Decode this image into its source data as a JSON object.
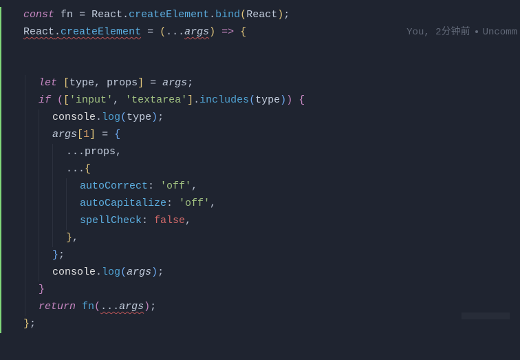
{
  "code": {
    "line1": {
      "const": "const",
      "varfn": "fn",
      "eq": " = ",
      "react": "React",
      "dot1": ".",
      "ce": "createElement",
      "dot2": ".",
      "bind": "bind",
      "lp": "(",
      "react2": "React",
      "rp": ")",
      "semi": ";"
    },
    "line2": {
      "react": "React",
      "dot": ".",
      "ce": "createElement",
      "eq": " = ",
      "lp": "(",
      "spread": "...",
      "args": "args",
      "rp": ")",
      "arrow": " => ",
      "lb": "{"
    },
    "line3": {
      "let": "let",
      "lsb": " [",
      "type": "type",
      "comma": ", ",
      "props": "props",
      "rsb": "] ",
      "eq": "= ",
      "args": "args",
      "semi": ";"
    },
    "line4": {
      "if": "if",
      "lp": " (",
      "lsb": "[",
      "s1": "'input'",
      "comma": ", ",
      "s2": "'textarea'",
      "rsb": "]",
      "dot": ".",
      "includes": "includes",
      "lp2": "(",
      "type": "type",
      "rp2": ")",
      "rp": ") ",
      "lb": "{"
    },
    "line5": {
      "console": "console",
      "dot": ".",
      "log": "log",
      "lp": "(",
      "type": "type",
      "rp": ")",
      "semi": ";"
    },
    "line6": {
      "args": "args",
      "lsb": "[",
      "one": "1",
      "rsb": "]",
      "eq": " = ",
      "lb": "{"
    },
    "line7": {
      "spread": "...",
      "props": "props",
      "comma": ","
    },
    "line8": {
      "spread": "...",
      "lb": "{"
    },
    "line9": {
      "key": "autoCorrect",
      "colon": ": ",
      "val": "'off'",
      "comma": ","
    },
    "line10": {
      "key": "autoCapitalize",
      "colon": ": ",
      "val": "'off'",
      "comma": ","
    },
    "line11": {
      "key": "spellCheck",
      "colon": ": ",
      "val": "false",
      "comma": ","
    },
    "line12": {
      "rb": "}",
      "comma": ","
    },
    "line13": {
      "rb": "}",
      "semi": ";"
    },
    "line14": {
      "console": "console",
      "dot": ".",
      "log": "log",
      "lp": "(",
      "args": "args",
      "rp": ")",
      "semi": ";"
    },
    "line15": {
      "rb": "}"
    },
    "line16": {
      "ret": "return",
      "sp": " ",
      "fn": "fn",
      "lp": "(",
      "spread": "...",
      "args": "args",
      "rp": ")",
      "semi": ";"
    },
    "line17": {
      "rb": "}",
      "semi": ";"
    }
  },
  "blame": {
    "author": "You",
    "sep": ", ",
    "time": "2分钟前",
    "status": "Uncomm"
  }
}
